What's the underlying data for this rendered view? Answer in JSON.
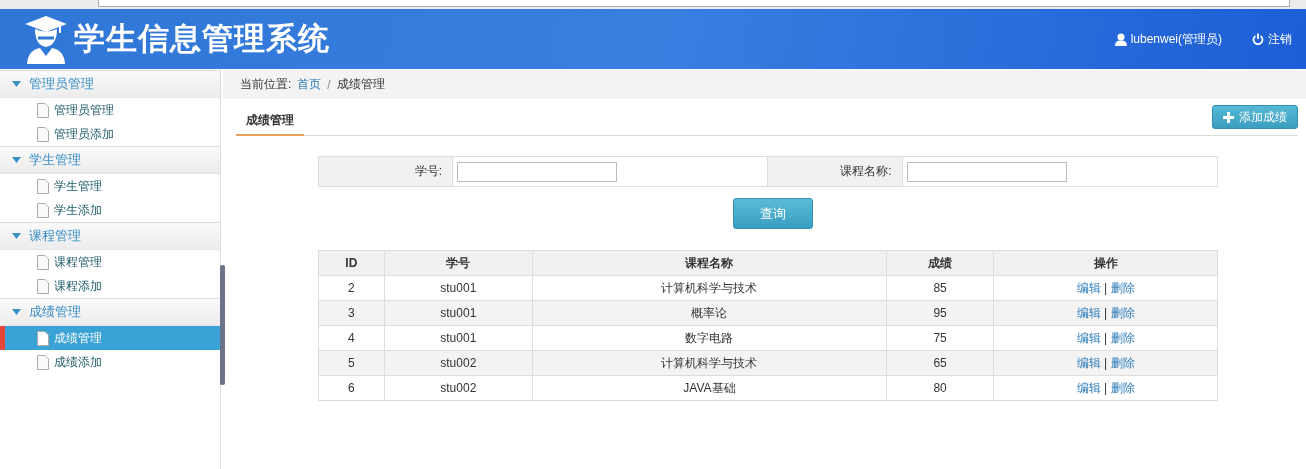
{
  "header": {
    "title": "学生信息管理系统",
    "user": "lubenwei(管理员)",
    "logout": "注销"
  },
  "sidebar": {
    "groups": [
      {
        "label": "管理员管理",
        "expanded": true,
        "items": [
          {
            "label": "管理员管理",
            "selected": false
          },
          {
            "label": "管理员添加",
            "selected": false
          }
        ]
      },
      {
        "label": "学生管理",
        "expanded": true,
        "items": [
          {
            "label": "学生管理",
            "selected": false
          },
          {
            "label": "学生添加",
            "selected": false
          }
        ]
      },
      {
        "label": "课程管理",
        "expanded": true,
        "items": [
          {
            "label": "课程管理",
            "selected": false
          },
          {
            "label": "课程添加",
            "selected": false
          }
        ]
      },
      {
        "label": "成绩管理",
        "expanded": true,
        "items": [
          {
            "label": "成绩管理",
            "selected": true
          },
          {
            "label": "成绩添加",
            "selected": false
          }
        ]
      }
    ]
  },
  "breadcrumb": {
    "prefix": "当前位置:",
    "separator": "/",
    "items": [
      "首页",
      "成绩管理"
    ]
  },
  "tabs": [
    {
      "label": "成绩管理",
      "selected": true
    }
  ],
  "add_button": "添加成绩",
  "search": {
    "fields": [
      {
        "label": "学号:"
      },
      {
        "label": "课程名称:"
      }
    ],
    "button": "查询"
  },
  "table": {
    "action_separator": "|",
    "columns": [
      "ID",
      "学号",
      "课程名称",
      "成绩",
      "操作"
    ],
    "rows": [
      {
        "cells": [
          "2",
          "stu001",
          "计算机科学与技术",
          "85"
        ],
        "actions": [
          "编辑",
          "删除"
        ]
      },
      {
        "cells": [
          "3",
          "stu001",
          "概率论",
          "95"
        ],
        "actions": [
          "编辑",
          "删除"
        ]
      },
      {
        "cells": [
          "4",
          "stu001",
          "数字电路",
          "75"
        ],
        "actions": [
          "编辑",
          "删除"
        ]
      },
      {
        "cells": [
          "5",
          "stu002",
          "计算机科学与技术",
          "65"
        ],
        "actions": [
          "编辑",
          "删除"
        ]
      },
      {
        "cells": [
          "6",
          "stu002",
          "JAVA基础",
          "80"
        ],
        "actions": [
          "编辑",
          "删除"
        ]
      }
    ]
  }
}
